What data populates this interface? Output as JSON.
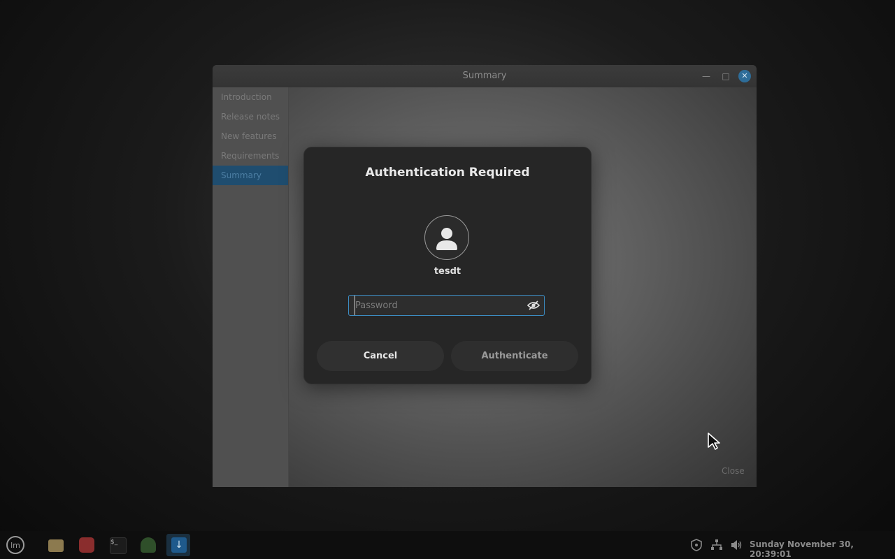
{
  "window": {
    "title": "Summary",
    "sidebar": [
      "Introduction",
      "Release notes",
      "New features",
      "Requirements",
      "Summary"
    ],
    "active_sidebar_index": 4,
    "close_label": "Close"
  },
  "dialog": {
    "title": "Authentication Required",
    "username": "tesdt",
    "password_placeholder": "Password",
    "password_value": "",
    "cancel_label": "Cancel",
    "authenticate_label": "Authenticate"
  },
  "taskbar": {
    "apps": [
      "menu-icon",
      "files-icon",
      "backup-icon",
      "terminal-icon",
      "update-manager-icon",
      "installer-icon"
    ],
    "tray": [
      "shield-icon",
      "network-icon",
      "volume-icon"
    ],
    "clock": "Sunday November 30, 20:39:01"
  },
  "colors": {
    "accent": "#3c8cc2",
    "dialog_bg": "#262626",
    "sidebar_active": "#1f4d6f"
  }
}
